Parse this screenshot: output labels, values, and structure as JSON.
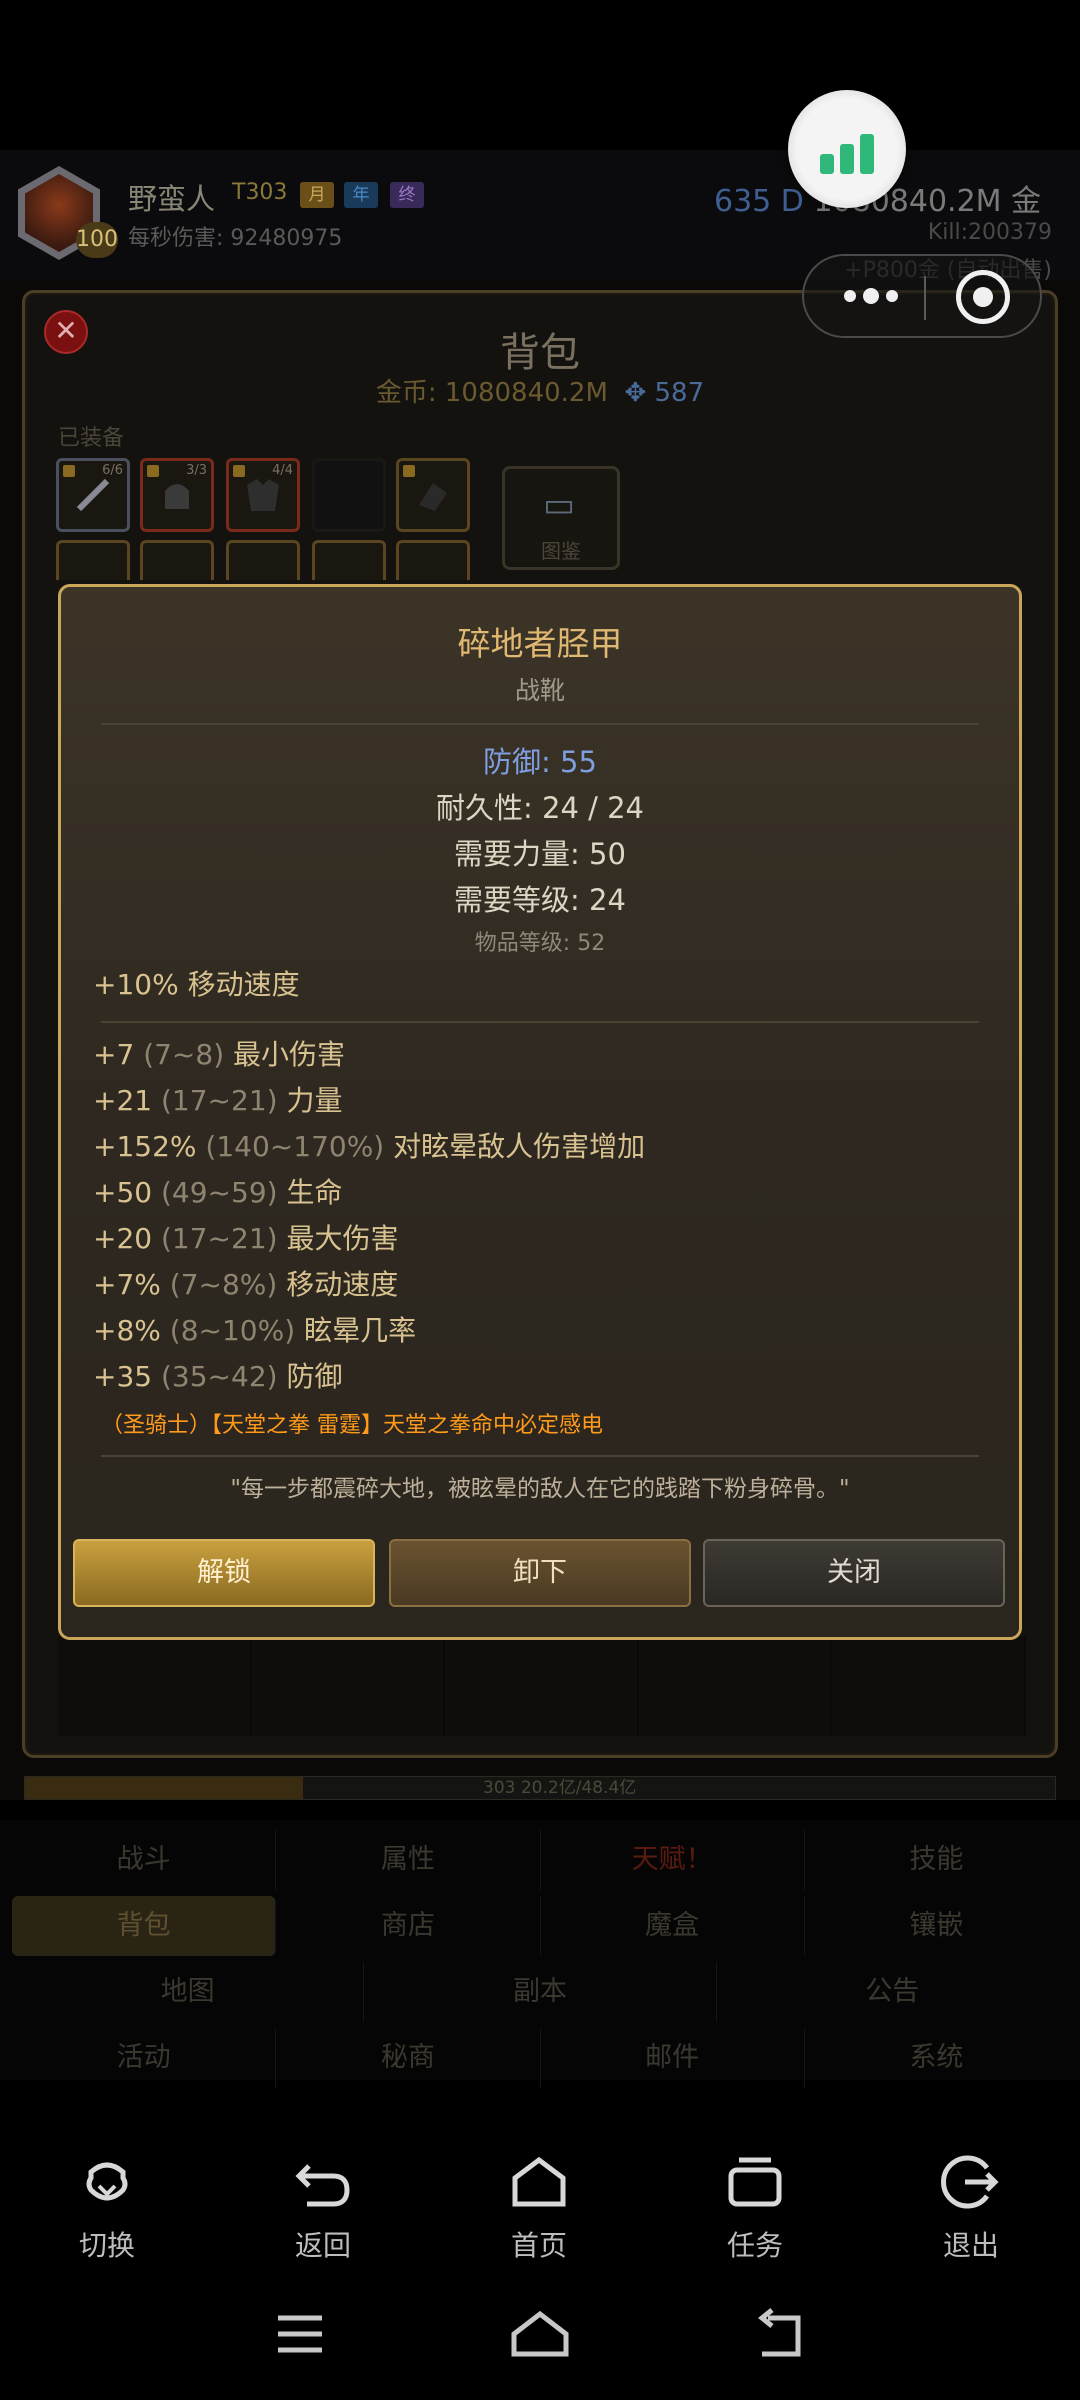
{
  "character": {
    "name": "野蛮人",
    "tier": "T303",
    "tags": [
      "月",
      "年",
      "终"
    ],
    "level": "100",
    "dps_label": "每秒伤害: 92480975",
    "currency": "635 D",
    "gold": "1080840.2M 金",
    "kills": "Kill:200379",
    "auto_text": "+P800金 (自动出售)"
  },
  "bag": {
    "title": "背包",
    "gold_line": "金币: 1080840.2M",
    "gems": "587",
    "equipped_label": "已装备",
    "slot_counts": [
      "6/6",
      "3/3",
      "4/4"
    ],
    "book_label": "图鉴"
  },
  "item": {
    "name": "碎地者胫甲",
    "type": "战靴",
    "defense": "防御: 55",
    "durability": "耐久性: 24 / 24",
    "req_str": "需要力量: 50",
    "req_level": "需要等级: 24",
    "item_level": "物品等级: 52",
    "implicit": "+10% 移动速度",
    "affixes": [
      {
        "value": "+7",
        "range": "(7~8)",
        "stat": "最小伤害"
      },
      {
        "value": "+21",
        "range": "(17~21)",
        "stat": "力量"
      },
      {
        "value": "+152%",
        "range": "(140~170%)",
        "stat": "对眩晕敌人伤害增加"
      },
      {
        "value": "+50",
        "range": "(49~59)",
        "stat": "生命"
      },
      {
        "value": "+20",
        "range": "(17~21)",
        "stat": "最大伤害"
      },
      {
        "value": "+7%",
        "range": "(7~8%)",
        "stat": "移动速度"
      },
      {
        "value": "+8%",
        "range": "(8~10%)",
        "stat": "眩晕几率"
      },
      {
        "value": "+35",
        "range": "(35~42)",
        "stat": "防御"
      }
    ],
    "set_bonus": "（圣骑士）【天堂之拳 雷霆】天堂之拳命中必定感电",
    "flavor": "\"每一步都震碎大地，被眩晕的敌人在它的践踏下粉身碎骨。\"",
    "buttons": {
      "unlock": "解锁",
      "unequip": "卸下",
      "close": "关闭"
    }
  },
  "progress": {
    "text": "303  20.2亿/48.4亿",
    "fill_fraction": 0.27
  },
  "menu": {
    "row1": [
      "战斗",
      "属性",
      "天赋！",
      "技能"
    ],
    "row2": [
      "背包",
      "商店",
      "魔盒",
      "镶嵌"
    ],
    "row3": [
      "地图",
      "副本",
      "公告"
    ],
    "row4": [
      "活动",
      "秘商",
      "邮件",
      "系统"
    ]
  },
  "host_nav": {
    "switch": "切换",
    "back": "返回",
    "home": "首页",
    "tasks": "任务",
    "exit": "退出"
  },
  "colors": {
    "gold_border": "#c9a65a",
    "defense_blue": "#7e9ee0",
    "set_orange": "#ff9a1a",
    "perf_green": "#2fb87a"
  }
}
